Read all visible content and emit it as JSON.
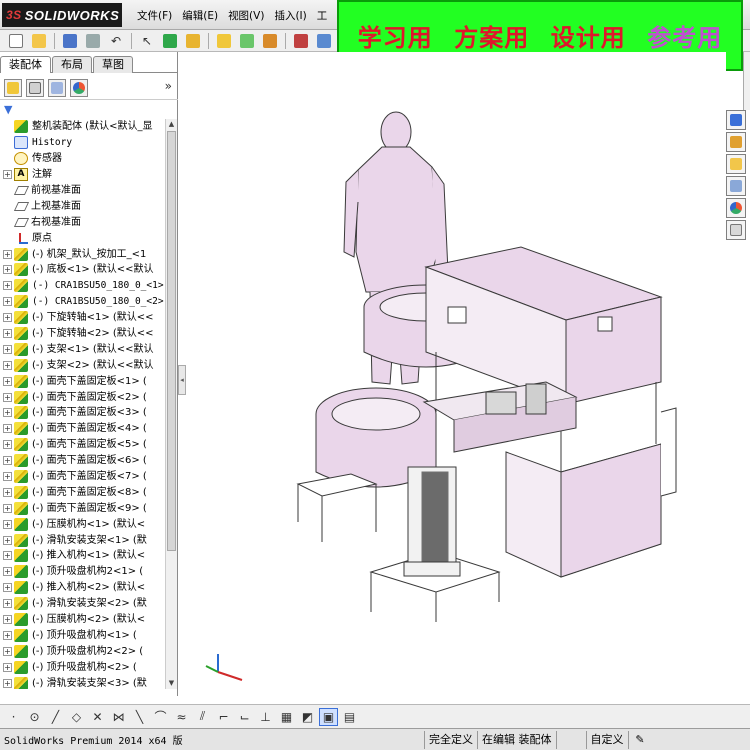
{
  "app": {
    "logo_prefix": "3S",
    "logo_text": "SOLIDWORKS",
    "menu": [
      "文件(F)",
      "编辑(E)",
      "视图(V)",
      "插入(I)",
      "工"
    ]
  },
  "banner": {
    "labels": [
      "学习用",
      "方案用",
      "设计用",
      "参考用"
    ]
  },
  "panel": {
    "tabs": [
      "装配体",
      "布局",
      "草图"
    ],
    "active_tab": "装配体",
    "chevron": "»",
    "filter_glyph": "▼"
  },
  "tree": {
    "items": [
      {
        "label": "整机装配体 (默认<默认_显",
        "icon": "asm",
        "expand": "",
        "mono": false
      },
      {
        "label": "History",
        "icon": "hist",
        "expand": "",
        "mono": true
      },
      {
        "label": "传感器",
        "icon": "sensor",
        "expand": "",
        "mono": false
      },
      {
        "label": "注解",
        "icon": "note",
        "expand": "+",
        "mono": false
      },
      {
        "label": "前视基准面",
        "icon": "plane",
        "expand": "",
        "mono": false
      },
      {
        "label": "上视基准面",
        "icon": "plane",
        "expand": "",
        "mono": false
      },
      {
        "label": "右视基准面",
        "icon": "plane",
        "expand": "",
        "mono": false
      },
      {
        "label": "原点",
        "icon": "origin",
        "expand": "",
        "mono": false
      },
      {
        "label": "(-) 机架_默认_按加工_<1",
        "icon": "part",
        "expand": "+",
        "mono": false
      },
      {
        "label": "(-) 底板<1> (默认<<默认",
        "icon": "part",
        "expand": "+",
        "mono": false
      },
      {
        "label": "(-) CRA1BSU50_180_0_<1>",
        "icon": "part",
        "expand": "+",
        "mono": true
      },
      {
        "label": "(-) CRA1BSU50_180_0_<2>",
        "icon": "part",
        "expand": "+",
        "mono": true
      },
      {
        "label": "(-) 下旋转轴<1> (默认<<",
        "icon": "part",
        "expand": "+",
        "mono": false
      },
      {
        "label": "(-) 下旋转轴<2> (默认<<",
        "icon": "part",
        "expand": "+",
        "mono": false
      },
      {
        "label": "(-) 支架<1> (默认<<默认",
        "icon": "part",
        "expand": "+",
        "mono": false
      },
      {
        "label": "(-) 支架<2> (默认<<默认",
        "icon": "part",
        "expand": "+",
        "mono": false
      },
      {
        "label": "(-) 面壳下盖固定板<1> (",
        "icon": "part",
        "expand": "+",
        "mono": false
      },
      {
        "label": "(-) 面壳下盖固定板<2> (",
        "icon": "part",
        "expand": "+",
        "mono": false
      },
      {
        "label": "(-) 面壳下盖固定板<3> (",
        "icon": "part",
        "expand": "+",
        "mono": false
      },
      {
        "label": "(-) 面壳下盖固定板<4> (",
        "icon": "part",
        "expand": "+",
        "mono": false
      },
      {
        "label": "(-) 面壳下盖固定板<5> (",
        "icon": "part",
        "expand": "+",
        "mono": false
      },
      {
        "label": "(-) 面壳下盖固定板<6> (",
        "icon": "part",
        "expand": "+",
        "mono": false
      },
      {
        "label": "(-) 面壳下盖固定板<7> (",
        "icon": "part",
        "expand": "+",
        "mono": false
      },
      {
        "label": "(-) 面壳下盖固定板<8> (",
        "icon": "part",
        "expand": "+",
        "mono": false
      },
      {
        "label": "(-) 面壳下盖固定板<9> (",
        "icon": "part",
        "expand": "+",
        "mono": false
      },
      {
        "label": "(-) 压膜机构<1> (默认<",
        "icon": "asm",
        "expand": "+",
        "mono": false
      },
      {
        "label": "(-) 滑轨安装支架<1> (默",
        "icon": "part",
        "expand": "+",
        "mono": false
      },
      {
        "label": "(-) 推入机构<1> (默认<",
        "icon": "asm",
        "expand": "+",
        "mono": false
      },
      {
        "label": "(-) 顶升吸盘机构2<1> (",
        "icon": "asm",
        "expand": "+",
        "mono": false
      },
      {
        "label": "(-) 推入机构<2> (默认<",
        "icon": "asm",
        "expand": "+",
        "mono": false
      },
      {
        "label": "(-) 滑轨安装支架<2> (默",
        "icon": "part",
        "expand": "+",
        "mono": false
      },
      {
        "label": "(-) 压膜机构<2> (默认<",
        "icon": "asm",
        "expand": "+",
        "mono": false
      },
      {
        "label": "(-) 顶升吸盘机构<1> (",
        "icon": "asm",
        "expand": "+",
        "mono": false
      },
      {
        "label": "(-) 顶升吸盘机构2<2> (",
        "icon": "asm",
        "expand": "+",
        "mono": false
      },
      {
        "label": "(-) 顶升吸盘机构<2> (",
        "icon": "asm",
        "expand": "+",
        "mono": false
      },
      {
        "label": "(-) 滑轨安装支架<3> (默",
        "icon": "part",
        "expand": "+",
        "mono": false
      }
    ]
  },
  "statusbar": {
    "app_version": "SolidWorks Premium 2014 x64 版",
    "cells": [
      "完全定义",
      "在编辑 装配体",
      "自定义"
    ]
  },
  "colors": {
    "banner_bg": "#22ff22",
    "banner_text": "#e0162b",
    "banner_last": "#c050d0",
    "model_fill": "#ead6ea",
    "model_edge": "#3a3a3a"
  }
}
